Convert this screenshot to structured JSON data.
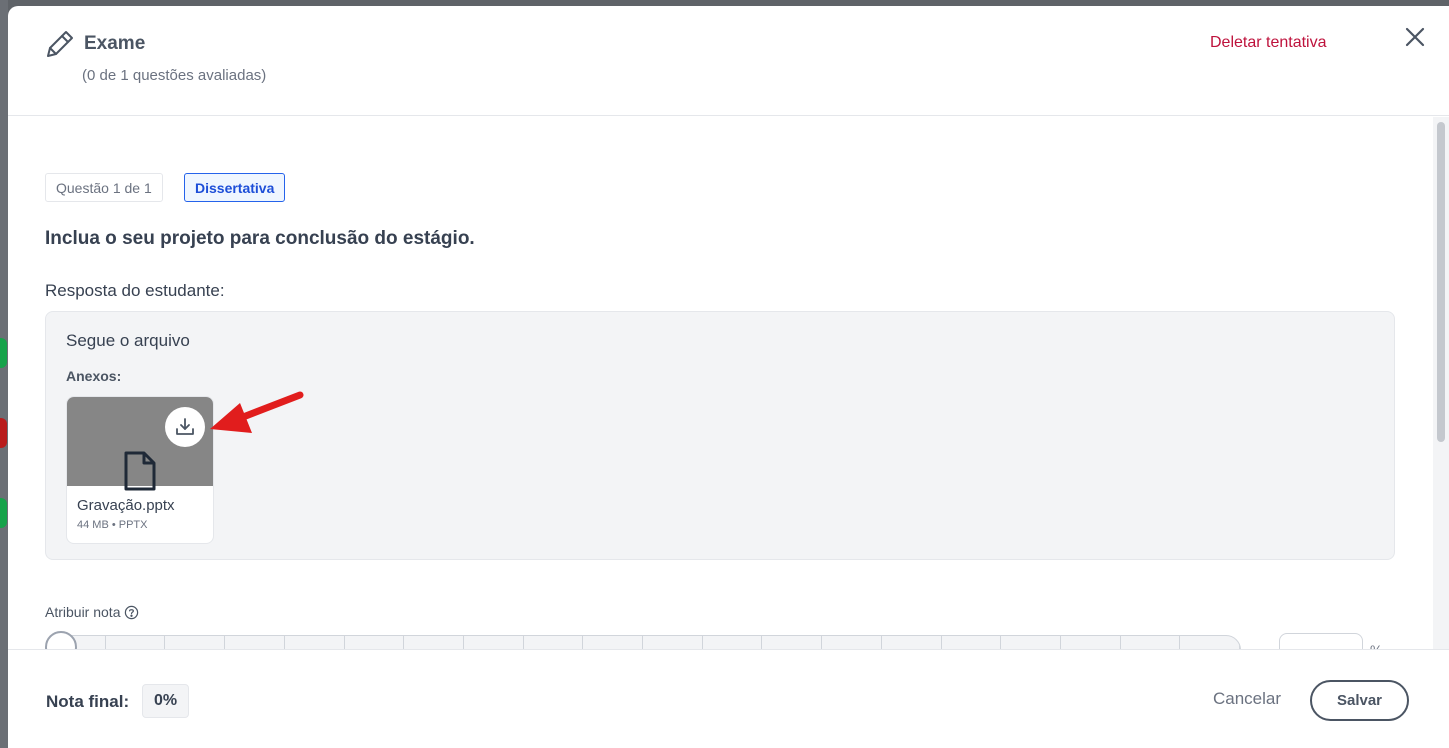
{
  "header": {
    "title": "Exame",
    "subtitle": "(0 de 1 questões avaliadas)",
    "delete_label": "Deletar tentativa"
  },
  "question": {
    "counter": "Questão 1 de 1",
    "type": "Dissertativa",
    "title": "Inclua o seu projeto para conclusão do estágio."
  },
  "answer": {
    "label": "Resposta do estudante:",
    "text": "Segue o arquivo",
    "attachments_label": "Anexos:",
    "file": {
      "name": "Gravação.pptx",
      "meta": "44 MB • PPTX"
    }
  },
  "grading": {
    "label": "Atribuir nota",
    "value": "",
    "percent_sign": "%",
    "slider_fraction": 0
  },
  "footer": {
    "final_label": "Nota final:",
    "final_value": "0%",
    "cancel_label": "Cancelar",
    "save_label": "Salvar"
  },
  "colors": {
    "accent_link": "#be123c",
    "type_badge": "#1d4ed8",
    "annotation_arrow": "#e11d1d"
  },
  "icons": [
    "pencil-icon",
    "close-icon",
    "download-icon",
    "file-icon",
    "help-icon",
    "arrow-annotation"
  ]
}
